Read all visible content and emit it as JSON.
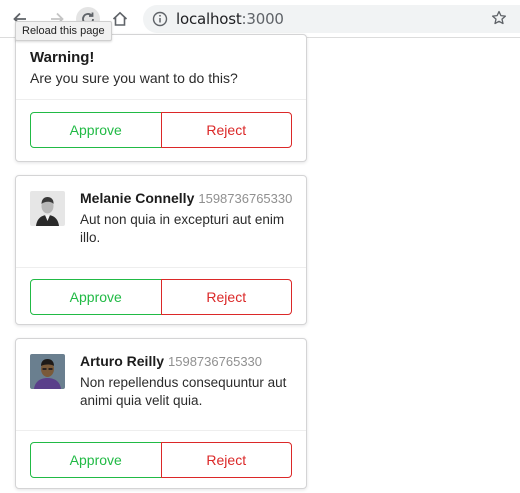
{
  "browser": {
    "url_host": "localhost",
    "url_port": ":3000",
    "tooltip": "Reload this page"
  },
  "cards": [
    {
      "type": "warning",
      "title": "Warning!",
      "text": "Are you sure you want to do this?",
      "approve_label": "Approve",
      "reject_label": "Reject"
    },
    {
      "type": "comment",
      "author": "Melanie Connelly",
      "metadata": "1598736765330",
      "text": "Aut non quia in excepturi aut enim illo.",
      "approve_label": "Approve",
      "reject_label": "Reject"
    },
    {
      "type": "comment",
      "author": "Arturo Reilly",
      "metadata": "1598736765330",
      "text": "Non repellendus consequuntur aut animi quia velit quia.",
      "approve_label": "Approve",
      "reject_label": "Reject"
    }
  ],
  "colors": {
    "approve": "#21ba45",
    "reject": "#db2828"
  }
}
